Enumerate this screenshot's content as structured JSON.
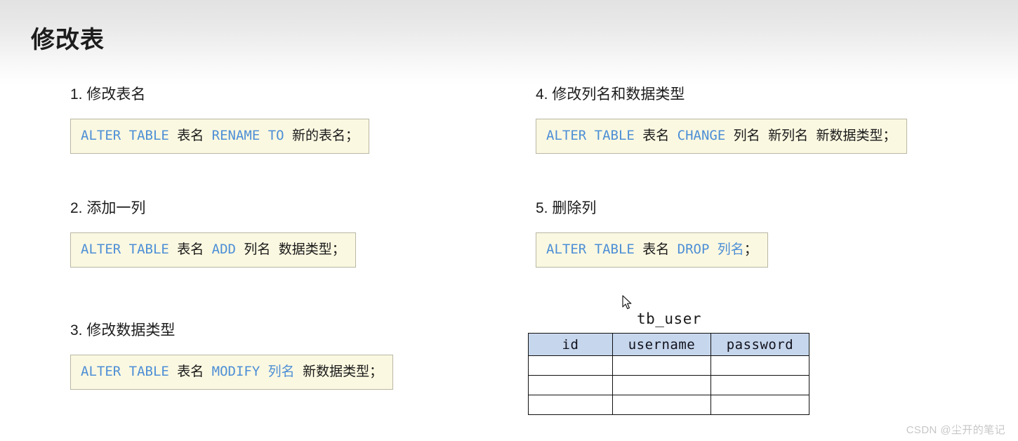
{
  "slide": {
    "title": "修改表",
    "background_top": "#e2e2e2",
    "background_bottom": "#ffffff"
  },
  "theme": {
    "keyword_color": "#4d8fd6",
    "code_background": "#fbf8e1",
    "code_border": "#b9b7a5",
    "table_header_fill": "#c6d6ec",
    "text_color": "#1a1a1a",
    "watermark_color": "#c7c7c7"
  },
  "items": [
    {
      "number": "1.",
      "heading": "修改表名",
      "code": {
        "kw1": "ALTER TABLE",
        "p1": "表名",
        "kw2": "RENAME TO",
        "p2": "新的表名",
        "end": "；"
      }
    },
    {
      "number": "2.",
      "heading": "添加一列",
      "code": {
        "kw1": "ALTER TABLE",
        "p1": "表名",
        "kw2": "ADD",
        "p2": "列名",
        "p3": "数据类型",
        "end": "；"
      }
    },
    {
      "number": "3.",
      "heading": "修改数据类型",
      "code": {
        "kw1": "ALTER TABLE",
        "p1": "表名",
        "kw2": "MODIFY",
        "p2": "列名",
        "p3": "新数据类型",
        "end": "；"
      }
    },
    {
      "number": "4.",
      "heading": "修改列名和数据类型",
      "code": {
        "kw1": "ALTER TABLE",
        "p1": "表名",
        "kw2": "CHANGE",
        "p2": "列名",
        "p3": "新列名",
        "p4": "新数据类型",
        "end": "；"
      }
    },
    {
      "number": "5.",
      "heading": "删除列",
      "code": {
        "kw1": "ALTER TABLE",
        "p1": "表名",
        "kw2": "DROP",
        "p2": "列名",
        "end": "；"
      }
    }
  ],
  "table_diagram": {
    "caption": "tb_user",
    "columns": [
      "id",
      "username",
      "password"
    ],
    "rows": [
      [
        "",
        "",
        ""
      ],
      [
        "",
        "",
        ""
      ],
      [
        "",
        "",
        ""
      ]
    ]
  },
  "watermark": "CSDN @尘开的笔记"
}
